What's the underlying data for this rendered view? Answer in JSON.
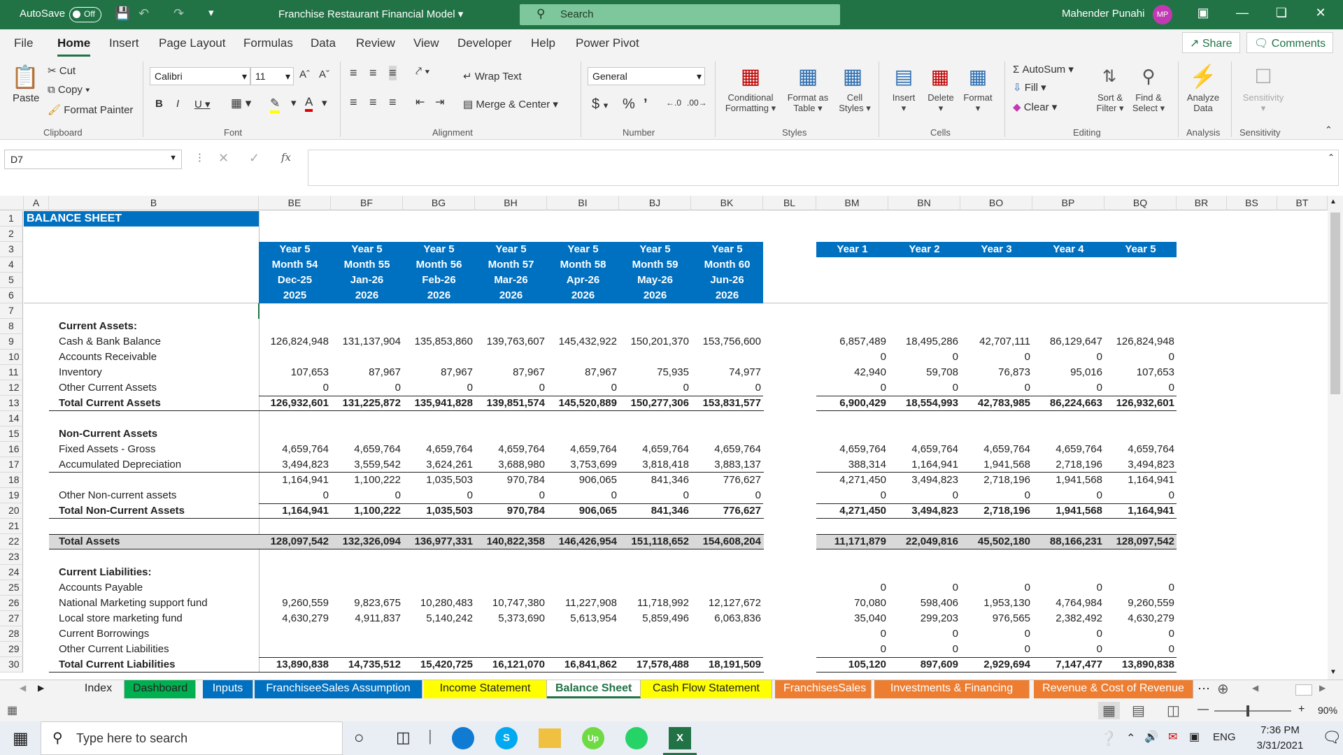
{
  "titlebar": {
    "autosave": "AutoSave",
    "autosave_state": "Off",
    "filename": "Franchise  Restaurant Financial Model",
    "search_placeholder": "Search",
    "user": "Mahender Punahi",
    "user_initials": "MP"
  },
  "menu": [
    "File",
    "Home",
    "Insert",
    "Page Layout",
    "Formulas",
    "Data",
    "Review",
    "View",
    "Developer",
    "Help",
    "Power Pivot"
  ],
  "share_label": "Share",
  "comments_label": "Comments",
  "ribbon": {
    "clipboard": {
      "paste": "Paste",
      "cut": "Cut",
      "copy": "Copy",
      "format_painter": "Format Painter",
      "group": "Clipboard"
    },
    "font": {
      "name": "Calibri",
      "size": "11",
      "group": "Font"
    },
    "alignment": {
      "wrap": "Wrap Text",
      "merge": "Merge & Center",
      "group": "Alignment"
    },
    "number": {
      "format": "General",
      "group": "Number"
    },
    "styles": {
      "cond1": "Conditional",
      "cond2": "Formatting",
      "fmt1": "Format as",
      "fmt2": "Table",
      "cell1": "Cell",
      "cell2": "Styles",
      "group": "Styles"
    },
    "cells": {
      "insert": "Insert",
      "delete": "Delete",
      "format": "Format",
      "group": "Cells"
    },
    "editing": {
      "autosum": "AutoSum",
      "fill": "Fill",
      "clear": "Clear",
      "sort1": "Sort &",
      "sort2": "Filter",
      "find1": "Find &",
      "find2": "Select",
      "group": "Editing"
    },
    "analysis": {
      "analyze1": "Analyze",
      "analyze2": "Data",
      "group": "Analysis"
    },
    "sensitivity": {
      "label": "Sensitivity",
      "group": "Sensitivity"
    }
  },
  "namebox": "D7",
  "fx": "fx",
  "columns": {
    "A": "A",
    "B": "B",
    "BE": "BE",
    "BF": "BF",
    "BG": "BG",
    "BH": "BH",
    "BI": "BI",
    "BJ": "BJ",
    "BK": "BK",
    "BL": "BL",
    "BM": "BM",
    "BN": "BN",
    "BO": "BO",
    "BP": "BP",
    "BQ": "BQ",
    "BR": "BR",
    "BS": "BS",
    "BT": "BT"
  },
  "sheet_title": "BALANCE SHEET",
  "monthly_headers": [
    {
      "year": "Year 5",
      "month": "Month 54",
      "date": "Dec-25",
      "fy": "2025"
    },
    {
      "year": "Year 5",
      "month": "Month 55",
      "date": "Jan-26",
      "fy": "2026"
    },
    {
      "year": "Year 5",
      "month": "Month 56",
      "date": "Feb-26",
      "fy": "2026"
    },
    {
      "year": "Year 5",
      "month": "Month 57",
      "date": "Mar-26",
      "fy": "2026"
    },
    {
      "year": "Year 5",
      "month": "Month 58",
      "date": "Apr-26",
      "fy": "2026"
    },
    {
      "year": "Year 5",
      "month": "Month 59",
      "date": "May-26",
      "fy": "2026"
    },
    {
      "year": "Year 5",
      "month": "Month 60",
      "date": "Jun-26",
      "fy": "2026"
    }
  ],
  "annual_headers": [
    "Year 1",
    "Year 2",
    "Year 3",
    "Year 4",
    "Year 5"
  ],
  "rows": [
    {
      "r": "8",
      "label": "Current Assets:",
      "bold": true,
      "m": [],
      "a": []
    },
    {
      "r": "9",
      "label": "Cash & Bank Balance",
      "m": [
        "126,824,948",
        "131,137,904",
        "135,853,860",
        "139,763,607",
        "145,432,922",
        "150,201,370",
        "153,756,600"
      ],
      "a": [
        "6,857,489",
        "18,495,286",
        "42,707,111",
        "86,129,647",
        "126,824,948"
      ]
    },
    {
      "r": "10",
      "label": "Accounts Receivable",
      "m": [],
      "a": [
        "0",
        "0",
        "0",
        "0",
        "0"
      ]
    },
    {
      "r": "11",
      "label": "Inventory",
      "m": [
        "107,653",
        "87,967",
        "87,967",
        "87,967",
        "87,967",
        "75,935",
        "74,977"
      ],
      "a": [
        "42,940",
        "59,708",
        "76,873",
        "95,016",
        "107,653"
      ]
    },
    {
      "r": "12",
      "label": "Other Current Assets",
      "m": [
        "0",
        "0",
        "0",
        "0",
        "0",
        "0",
        "0"
      ],
      "a": [
        "0",
        "0",
        "0",
        "0",
        "0"
      ]
    },
    {
      "r": "13",
      "label": "Total Current Assets",
      "bold": true,
      "m": [
        "126,932,601",
        "131,225,872",
        "135,941,828",
        "139,851,574",
        "145,520,889",
        "150,277,306",
        "153,831,577"
      ],
      "a": [
        "6,900,429",
        "18,554,993",
        "42,783,985",
        "86,224,663",
        "126,932,601"
      ]
    },
    {
      "r": "15",
      "label": "Non-Current Assets",
      "bold": true,
      "m": [],
      "a": []
    },
    {
      "r": "16",
      "label": "Fixed Assets - Gross",
      "m": [
        "4,659,764",
        "4,659,764",
        "4,659,764",
        "4,659,764",
        "4,659,764",
        "4,659,764",
        "4,659,764"
      ],
      "a": [
        "4,659,764",
        "4,659,764",
        "4,659,764",
        "4,659,764",
        "4,659,764"
      ]
    },
    {
      "r": "17",
      "label": "Accumulated Depreciation",
      "m": [
        "3,494,823",
        "3,559,542",
        "3,624,261",
        "3,688,980",
        "3,753,699",
        "3,818,418",
        "3,883,137"
      ],
      "a": [
        "388,314",
        "1,164,941",
        "1,941,568",
        "2,718,196",
        "3,494,823"
      ]
    },
    {
      "r": "18",
      "label": "",
      "m": [
        "1,164,941",
        "1,100,222",
        "1,035,503",
        "970,784",
        "906,065",
        "841,346",
        "776,627"
      ],
      "a": [
        "4,271,450",
        "3,494,823",
        "2,718,196",
        "1,941,568",
        "1,164,941"
      ]
    },
    {
      "r": "19",
      "label": "Other Non-current assets",
      "m": [
        "0",
        "0",
        "0",
        "0",
        "0",
        "0",
        "0"
      ],
      "a": [
        "0",
        "0",
        "0",
        "0",
        "0"
      ]
    },
    {
      "r": "20",
      "label": "Total Non-Current Assets",
      "bold": true,
      "m": [
        "1,164,941",
        "1,100,222",
        "1,035,503",
        "970,784",
        "906,065",
        "841,346",
        "776,627"
      ],
      "a": [
        "4,271,450",
        "3,494,823",
        "2,718,196",
        "1,941,568",
        "1,164,941"
      ]
    },
    {
      "r": "22",
      "label": "Total Assets",
      "bold": true,
      "m": [
        "128,097,542",
        "132,326,094",
        "136,977,331",
        "140,822,358",
        "146,426,954",
        "151,118,652",
        "154,608,204"
      ],
      "a": [
        "11,171,879",
        "22,049,816",
        "45,502,180",
        "88,166,231",
        "128,097,542"
      ]
    },
    {
      "r": "24",
      "label": "Current Liabilities:",
      "bold": true,
      "m": [],
      "a": []
    },
    {
      "r": "25",
      "label": "Accounts Payable",
      "m": [],
      "a": [
        "0",
        "0",
        "0",
        "0",
        "0"
      ]
    },
    {
      "r": "26",
      "label": "National Marketing support fund",
      "m": [
        "9,260,559",
        "9,823,675",
        "10,280,483",
        "10,747,380",
        "11,227,908",
        "11,718,992",
        "12,127,672"
      ],
      "a": [
        "70,080",
        "598,406",
        "1,953,130",
        "4,764,984",
        "9,260,559"
      ]
    },
    {
      "r": "27",
      "label": "Local store marketing fund",
      "m": [
        "4,630,279",
        "4,911,837",
        "5,140,242",
        "5,373,690",
        "5,613,954",
        "5,859,496",
        "6,063,836"
      ],
      "a": [
        "35,040",
        "299,203",
        "976,565",
        "2,382,492",
        "4,630,279"
      ]
    },
    {
      "r": "28",
      "label": "Current Borrowings",
      "m": [],
      "a": [
        "0",
        "0",
        "0",
        "0",
        "0"
      ]
    },
    {
      "r": "29",
      "label": "Other Current Liabilities",
      "m": [],
      "a": [
        "0",
        "0",
        "0",
        "0",
        "0"
      ]
    },
    {
      "r": "30",
      "label": "Total Current Liabilities",
      "bold": true,
      "m": [
        "13,890,838",
        "14,735,512",
        "15,420,725",
        "16,121,070",
        "16,841,862",
        "17,578,488",
        "18,191,509"
      ],
      "a": [
        "105,120",
        "897,609",
        "2,929,694",
        "7,147,477",
        "13,890,838"
      ]
    }
  ],
  "tabs": [
    {
      "label": "Index",
      "bg": "#f3f3f3"
    },
    {
      "label": "Dashboard",
      "bg": "#00b050"
    },
    {
      "label": "Inputs",
      "bg": "#0070c0",
      "fg": "#fff"
    },
    {
      "label": "FranchiseeSales Assumption",
      "bg": "#0070c0",
      "fg": "#fff"
    },
    {
      "label": "Income Statement",
      "bg": "#ffff00"
    },
    {
      "label": "Balance Sheet",
      "bg": "#ffffff",
      "active": true
    },
    {
      "label": "Cash Flow Statement",
      "bg": "#ffff00"
    },
    {
      "label": "FranchisesSales",
      "bg": "#ed7d31",
      "fg": "#fff"
    },
    {
      "label": "Investments & Financing",
      "bg": "#ed7d31",
      "fg": "#fff"
    },
    {
      "label": "Revenue & Cost of Revenue",
      "bg": "#ed7d31",
      "fg": "#fff"
    }
  ],
  "zoom": "90%",
  "taskbar": {
    "search": "Type here to search",
    "lang": "ENG",
    "time": "7:36 PM",
    "date": "3/31/2021"
  }
}
